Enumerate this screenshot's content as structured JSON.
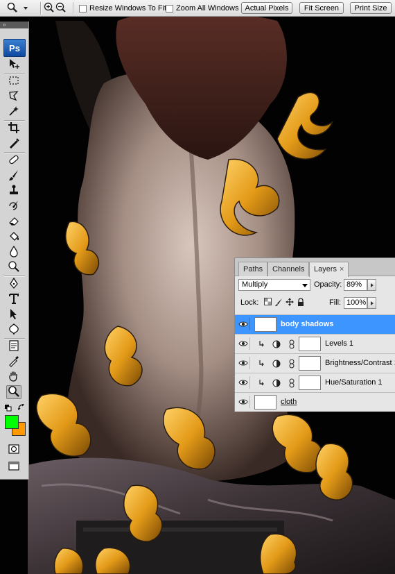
{
  "options_bar": {
    "zoom_tool_icon": "magnifier-icon",
    "zoom_in_icon": "zoom-in-icon",
    "zoom_out_icon": "zoom-out-icon",
    "resize_windows_label": "Resize Windows To Fit",
    "resize_windows_checked": false,
    "zoom_all_label": "Zoom All Windows",
    "zoom_all_checked": false,
    "actual_pixels_label": "Actual Pixels",
    "fit_screen_label": "Fit Screen",
    "print_size_label": "Print Size"
  },
  "tools_panel": {
    "collapse_glyph": "»",
    "logo": "Ps",
    "active_tool": "zoom",
    "foreground_color": "#00ff00",
    "background_color": "#ff9900",
    "tools": [
      "move",
      "marquee",
      "lasso",
      "magic-wand",
      "crop",
      "slice",
      "healing-brush",
      "brush",
      "clone-stamp",
      "history-brush",
      "eraser",
      "paint-bucket",
      "blur",
      "dodge",
      "pen",
      "type",
      "path-selection",
      "custom-shape",
      "notes",
      "eyedropper",
      "hand",
      "zoom"
    ]
  },
  "layers_panel": {
    "tabs": [
      "Paths",
      "Channels",
      "Layers"
    ],
    "active_tab": "Layers",
    "close_glyph": "×",
    "blend_mode": "Multiply",
    "opacity_label": "Opacity:",
    "opacity_value": "89%",
    "lock_label": "Lock:",
    "fill_label": "Fill:",
    "fill_value": "100%",
    "layers": [
      {
        "name": "body shadows",
        "selected": true,
        "clipped": false,
        "adjustment": false,
        "thumb": "transparent"
      },
      {
        "name": "Levels 1",
        "selected": false,
        "clipped": true,
        "adjustment": true,
        "thumb": "mask-white"
      },
      {
        "name": "Brightness/Contrast 1",
        "selected": false,
        "clipped": true,
        "adjustment": true,
        "thumb": "mask-white"
      },
      {
        "name": "Hue/Saturation 1",
        "selected": false,
        "clipped": true,
        "adjustment": true,
        "thumb": "mask-white"
      },
      {
        "name": "cloth",
        "selected": false,
        "clipped": false,
        "adjustment": false,
        "thumb": "transparent"
      }
    ]
  },
  "colors": {
    "selection_blue": "#3d95ff",
    "ps_logo_blue": "#1a5fb8",
    "ornament_gold": "#e39a18"
  }
}
